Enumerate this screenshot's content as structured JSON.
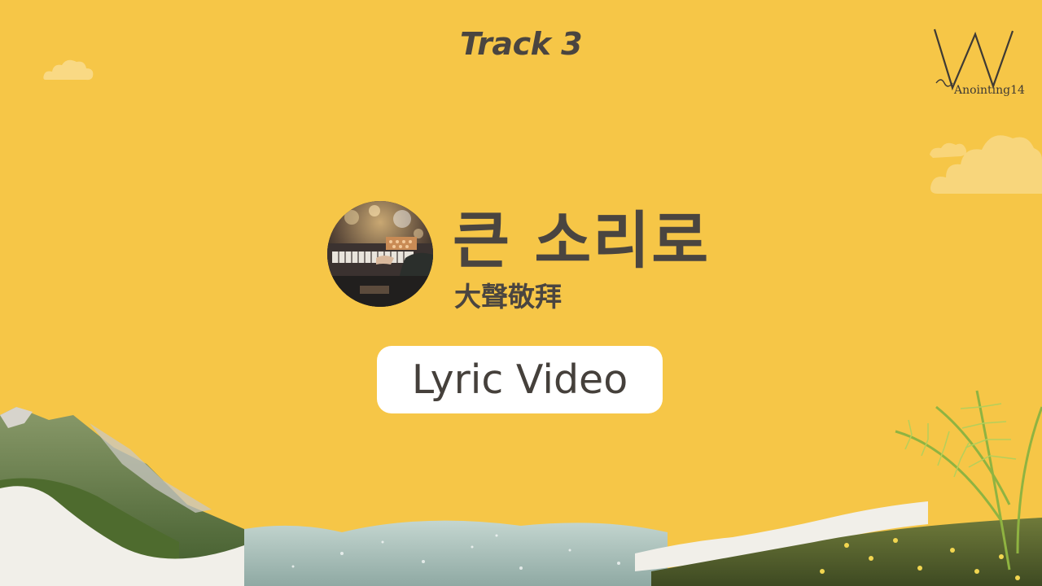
{
  "header": {
    "track_label": "Track 3"
  },
  "logo": {
    "icon": "w-logo-icon",
    "text": "Anointing14"
  },
  "song": {
    "title": "큰 소리로",
    "subtitle": "大聲敬拜",
    "cover_icon": "keyboard-player-photo"
  },
  "badge": {
    "label": "Lyric Video"
  },
  "colors": {
    "background": "#f6c647",
    "text": "#4a4540",
    "pill": "#ffffff"
  }
}
